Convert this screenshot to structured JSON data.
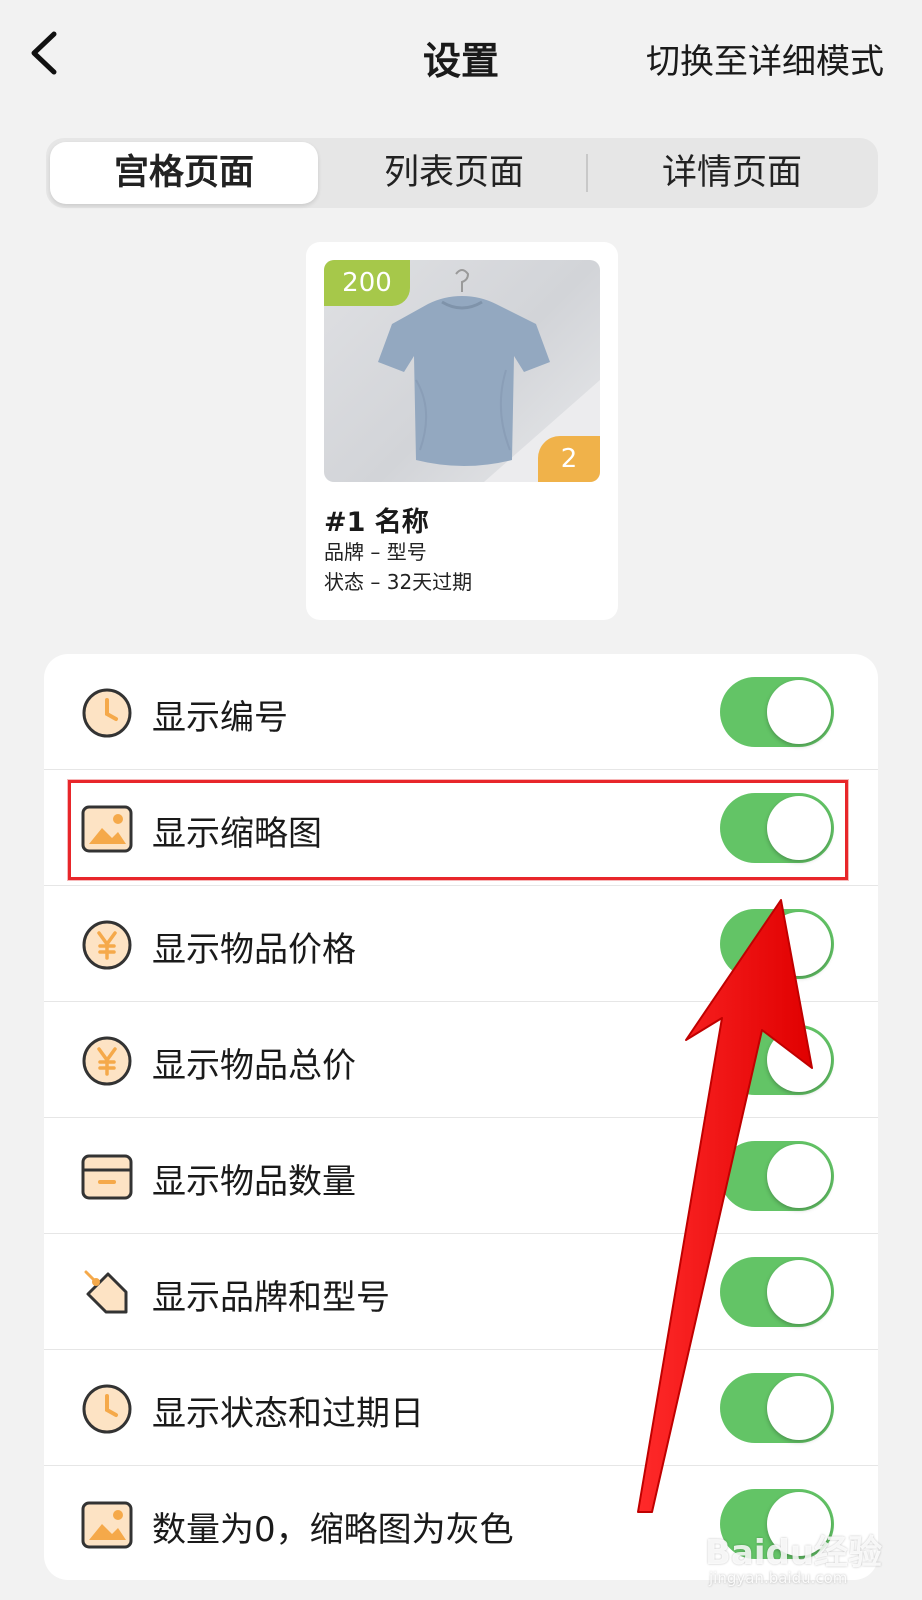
{
  "navbar": {
    "title": "设置",
    "action_label": "切换至详细模式"
  },
  "tabs": [
    {
      "label": "宫格页面",
      "active": true
    },
    {
      "label": "列表页面",
      "active": false
    },
    {
      "label": "详情页面",
      "active": false
    }
  ],
  "preview_card": {
    "number_badge": "200",
    "quantity_badge": "2",
    "name": "#1 名称",
    "brand_model": "品牌 – 型号",
    "status_expiry": "状态 – 32天过期",
    "badge_colors": {
      "number": "#a6c84a",
      "quantity": "#f0b24a"
    }
  },
  "settings": [
    {
      "label": "显示编号",
      "icon": "clock-icon",
      "enabled": true
    },
    {
      "label": "显示缩略图",
      "icon": "image-icon",
      "enabled": true,
      "highlighted": true
    },
    {
      "label": "显示物品价格",
      "icon": "yuan-icon",
      "enabled": true
    },
    {
      "label": "显示物品总价",
      "icon": "yuan-icon",
      "enabled": true
    },
    {
      "label": "显示物品数量",
      "icon": "box-icon",
      "enabled": true
    },
    {
      "label": "显示品牌和型号",
      "icon": "tag-icon",
      "enabled": true
    },
    {
      "label": "显示状态和过期日",
      "icon": "clock-icon",
      "enabled": true
    },
    {
      "label": "数量为0，缩略图为灰色",
      "icon": "image-icon",
      "enabled": true
    }
  ],
  "colors": {
    "toggle_on": "#63c466",
    "icon_accent": "#f5a94a",
    "annotation": "#e8262a"
  },
  "watermark": {
    "logo": "Baidu经验",
    "url": "jingyan.baidu.com"
  }
}
